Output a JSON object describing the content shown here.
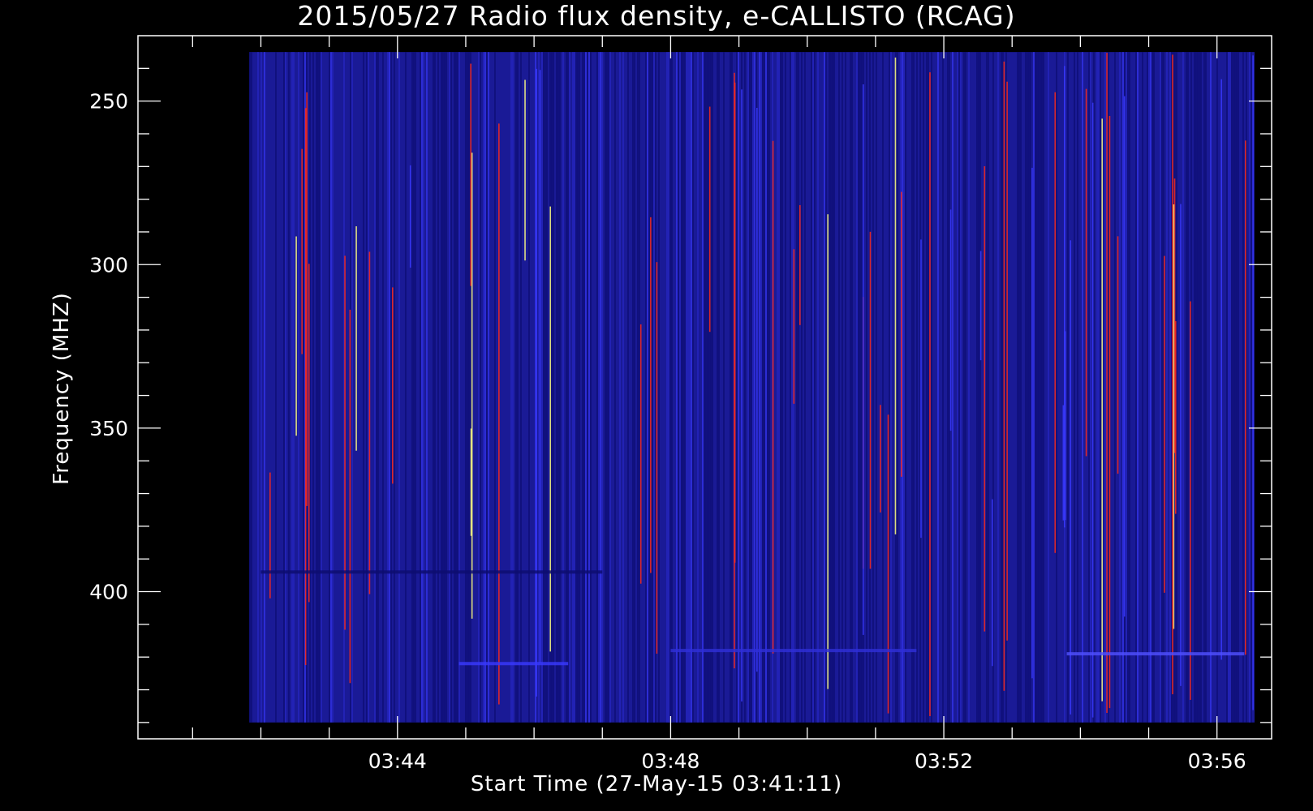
{
  "chart_data": {
    "type": "heatmap",
    "title": "2015/05/27  Radio flux density, e-CALLISTO (RCAG)",
    "xlabel": "Start Time (27-May-15 03:41:11)",
    "ylabel": "Frequency (MHZ)",
    "x_ticks": [
      "03:44",
      "03:48",
      "03:52",
      "03:56"
    ],
    "x_tick_minutes": [
      224,
      228,
      232,
      236
    ],
    "y_ticks": [
      250,
      300,
      350,
      400
    ],
    "xlim_minutes": [
      220.2,
      236.8
    ],
    "ylim_mhz": [
      230,
      445
    ],
    "data_extent": {
      "start_minutes": 221.83,
      "end_minutes": 236.55,
      "freq_low_mhz": 235,
      "freq_high_mhz": 440
    },
    "y_inverted": true,
    "grid": false,
    "colormap": {
      "background": "#1a1a96",
      "low": "#0c0c6e",
      "mid": "#3a3aff",
      "high": "#ff2a1a",
      "peak": "#ffff80"
    }
  }
}
